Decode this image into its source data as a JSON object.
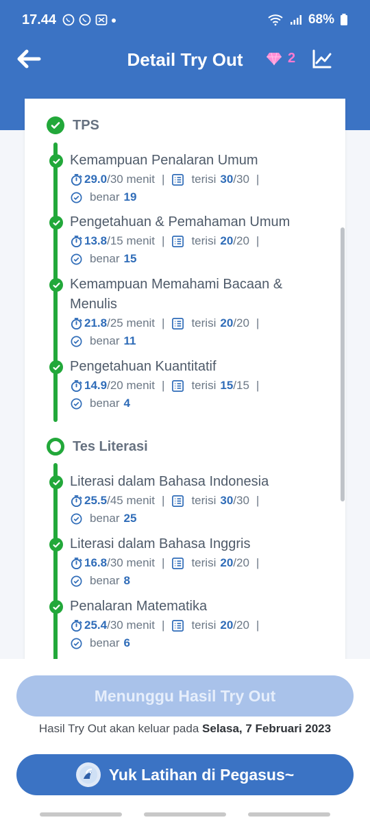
{
  "status": {
    "time": "17.44",
    "battery": "68%"
  },
  "header": {
    "title": "Detail Try Out",
    "gems": "2"
  },
  "sections": [
    {
      "title": "TPS",
      "items": [
        {
          "title": "Kemampuan Penalaran Umum",
          "time_used": "29.0",
          "time_total": "/30 menit",
          "filled_label": "terisi",
          "filled": "30",
          "filled_total": "/30",
          "correct_label": "benar",
          "correct": "19"
        },
        {
          "title": "Pengetahuan & Pemahaman Umum",
          "time_used": "13.8",
          "time_total": "/15 menit",
          "filled_label": "terisi",
          "filled": "20",
          "filled_total": "/20",
          "correct_label": "benar",
          "correct": "15"
        },
        {
          "title": "Kemampuan Memahami Bacaan & Menulis",
          "time_used": "21.8",
          "time_total": "/25 menit",
          "filled_label": "terisi",
          "filled": "20",
          "filled_total": "/20",
          "correct_label": "benar",
          "correct": "11"
        },
        {
          "title": "Pengetahuan Kuantitatif",
          "time_used": "14.9",
          "time_total": "/20 menit",
          "filled_label": "terisi",
          "filled": "15",
          "filled_total": "/15",
          "correct_label": "benar",
          "correct": "4"
        }
      ]
    },
    {
      "title": "Tes Literasi",
      "items": [
        {
          "title": "Literasi dalam Bahasa Indonesia",
          "time_used": "25.5",
          "time_total": "/45 menit",
          "filled_label": "terisi",
          "filled": "30",
          "filled_total": "/30",
          "correct_label": "benar",
          "correct": "25"
        },
        {
          "title": "Literasi dalam Bahasa Inggris",
          "time_used": "16.8",
          "time_total": "/30 menit",
          "filled_label": "terisi",
          "filled": "20",
          "filled_total": "/20",
          "correct_label": "benar",
          "correct": "8"
        },
        {
          "title": "Penalaran Matematika",
          "time_used": "25.4",
          "time_total": "/30 menit",
          "filled_label": "terisi",
          "filled": "20",
          "filled_total": "/20",
          "correct_label": "benar",
          "correct": "6"
        }
      ]
    }
  ],
  "footer": {
    "wait_label": "Menunggu Hasil Try Out",
    "note_prefix": "Hasil Try Out akan keluar pada",
    "note_date": "Selasa, 7 Februari 2023",
    "practice_label": "Yuk Latihan di Pegasus~"
  },
  "colors": {
    "primary": "#3b73c4",
    "success": "#22a83a",
    "gem": "#ff7ad1",
    "value": "#2f6cb8"
  }
}
